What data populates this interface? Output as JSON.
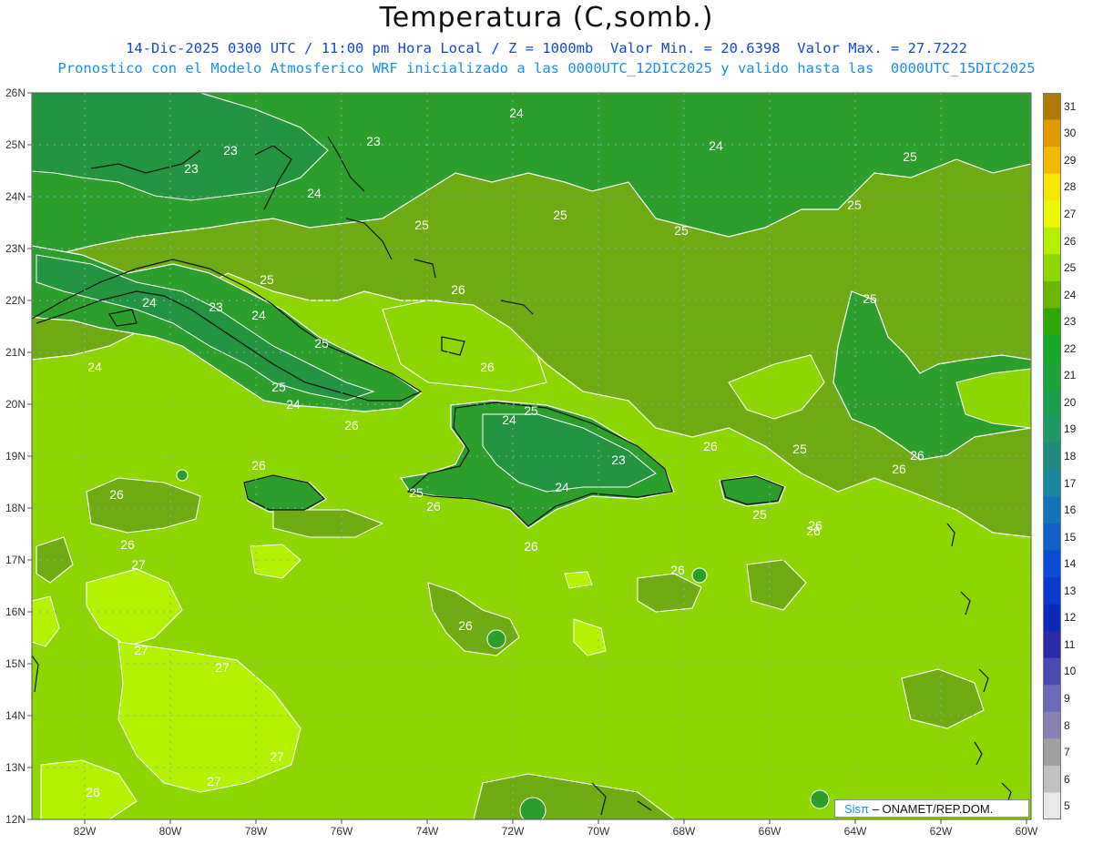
{
  "title": "Temperatura (C,somb.)",
  "subtitle_line1": "14-Dic-2025 0300 UTC / 11:00 pm Hora Local / Z = 1000mb  Valor Min. = 20.6398  Valor Max. = 27.7222",
  "subtitle_line2": "Pronostico con el Modelo Atmosferico WRF inicializado a las 0000UTC_12DIC2025 y valido hasta las  0000UTC_15DIC2025",
  "credit": {
    "brand": "Sisπ",
    "separator": " – ",
    "org": "ONAMET/REP.DOM."
  },
  "lat_labels": [
    "26N",
    "25N",
    "24N",
    "23N",
    "22N",
    "21N",
    "20N",
    "19N",
    "18N",
    "17N",
    "16N",
    "15N",
    "14N",
    "13N",
    "12N"
  ],
  "lon_labels": [
    "82W",
    "80W",
    "78W",
    "76W",
    "74W",
    "72W",
    "70W",
    "68W",
    "66W",
    "64W",
    "62W",
    "60W"
  ],
  "colorbar": {
    "levels": [
      "31",
      "30",
      "29",
      "28",
      "27",
      "26",
      "25",
      "24",
      "23",
      "22",
      "21",
      "20",
      "19",
      "18",
      "17",
      "16",
      "15",
      "14",
      "13",
      "12",
      "11",
      "10",
      "9",
      "8",
      "7",
      "6",
      "5"
    ],
    "colors": [
      "#b07a00",
      "#e09a00",
      "#f5b800",
      "#f7e400",
      "#ecf600",
      "#b6ee00",
      "#8cd800",
      "#6bb600",
      "#2ea800",
      "#16a828",
      "#1ea23a",
      "#19a04c",
      "#1f9a66",
      "#1e8a80",
      "#17889e",
      "#1373b8",
      "#1060c8",
      "#0a4dd4",
      "#0a3ac8",
      "#0a2bb8",
      "#2a2aa8",
      "#4a4ab0",
      "#6a6ab8",
      "#8a80b8",
      "#a0a0a0",
      "#c0c0c0",
      "#e8e8e8"
    ]
  },
  "map_colors": {
    "c23": "#23943f",
    "c24": "#2c9e2c",
    "c25": "#6fac14",
    "c26": "#8ed600",
    "c27": "#b3f200",
    "coast": "#111111",
    "contour": "#ffffff"
  },
  "contour_labels": [
    "24",
    "24",
    "23",
    "23",
    "23",
    "24",
    "25",
    "25",
    "25",
    "25",
    "25",
    "24",
    "23",
    "25",
    "24",
    "25",
    "25",
    "24",
    "26",
    "26",
    "26",
    "25",
    "24",
    "23",
    "24",
    "25",
    "26",
    "26",
    "26",
    "26",
    "27",
    "27",
    "27",
    "27",
    "27",
    "26",
    "26",
    "26",
    "26",
    "25",
    "26",
    "25",
    "26",
    "26",
    "26",
    "26",
    "25",
    "24"
  ]
}
